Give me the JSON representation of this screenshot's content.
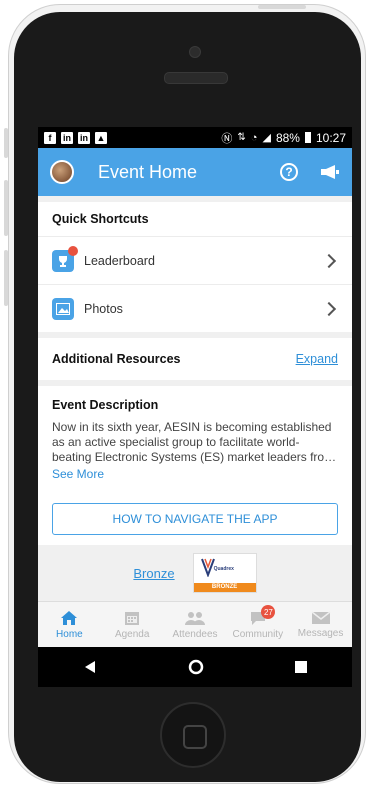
{
  "status_bar": {
    "battery": "88%",
    "time": "10:27",
    "notification_icons": [
      "facebook-icon",
      "linkedin-icon",
      "linkedin-icon",
      "image-icon"
    ]
  },
  "app_bar": {
    "title": "Event Home",
    "help_icon_glyph": "?",
    "color": "#4aa3e6"
  },
  "quick_shortcuts": {
    "title": "Quick Shortcuts",
    "items": [
      {
        "label": "Leaderboard",
        "icon": "trophy-icon"
      },
      {
        "label": "Photos",
        "icon": "photo-icon"
      }
    ]
  },
  "additional_resources": {
    "title": "Additional Resources",
    "expand_label": "Expand"
  },
  "event_description": {
    "title": "Event Description",
    "text": "Now in its sixth year, AESIN is becoming established as an active specialist group to facilitate world-beating Electronic Systems (ES) market leaders fro…",
    "see_more": "See More"
  },
  "navigate_button": "HOW TO NAVIGATE THE APP",
  "sponsor": {
    "tier_link": "Bronze",
    "logo_name": "Quadrex",
    "logo_tier": "BRONZE"
  },
  "tabs": [
    {
      "label": "Home",
      "icon": "home-icon",
      "active": true
    },
    {
      "label": "Agenda",
      "icon": "calendar-icon",
      "active": false
    },
    {
      "label": "Attendees",
      "icon": "people-icon",
      "active": false
    },
    {
      "label": "Community",
      "icon": "chat-icon",
      "active": false,
      "badge": "27"
    },
    {
      "label": "Messages",
      "icon": "envelope-icon",
      "active": false
    }
  ]
}
